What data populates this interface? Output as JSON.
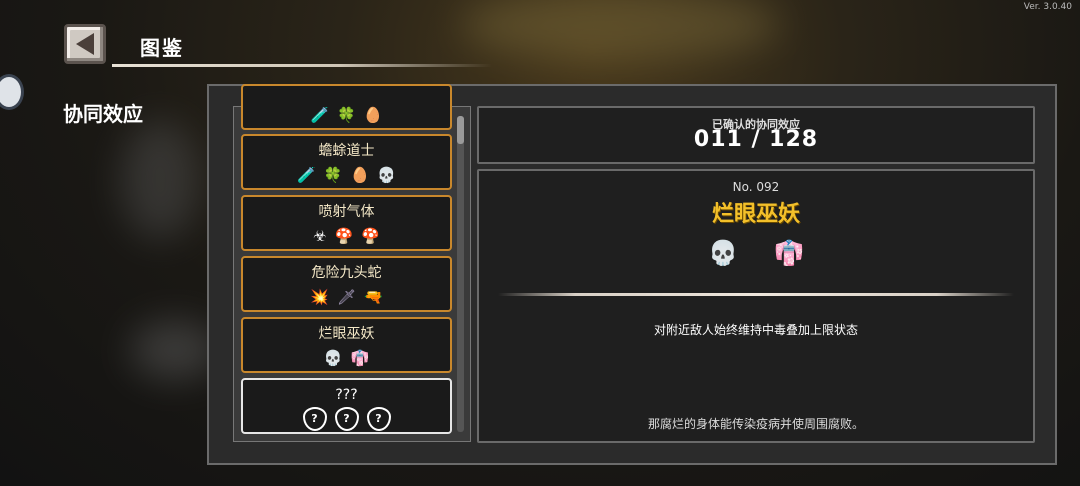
{
  "version": "Ver. 3.0.40",
  "header": {
    "title": "图鉴"
  },
  "side_heading": "协同效应",
  "list": {
    "cards": [
      {
        "name": "",
        "icons": [
          "🧪",
          "🍀",
          "🥚"
        ],
        "colors": [
          "#7a4ab0",
          "#4ea83a",
          "#c0548a"
        ],
        "partial": true
      },
      {
        "name": "蟾蜍道士",
        "icons": [
          "🧪",
          "🍀",
          "🥚",
          "💀"
        ],
        "colors": [
          "#7a4ab0",
          "#4ea83a",
          "#c0548a",
          "#cfc0a6"
        ]
      },
      {
        "name": "喷射气体",
        "icons": [
          "☣",
          "🍄",
          "🍄"
        ],
        "colors": [
          "#ffffff",
          "#4a8ed8",
          "#d2473a"
        ]
      },
      {
        "name": "危险九头蛇",
        "icons": [
          "💥",
          "🗡",
          "🔫"
        ],
        "colors": [
          "#ffffff",
          "#b0a4c8",
          "#a05a4a"
        ]
      },
      {
        "name": "烂眼巫妖",
        "icons": [
          "💀",
          "👘"
        ],
        "colors": [
          "#cfc0a6",
          "#c24aa0"
        ]
      },
      {
        "name": "???",
        "icons": [
          "?",
          "?",
          "?"
        ],
        "colors": [
          "#ffffff",
          "#ffffff",
          "#ffffff"
        ],
        "unknown": true
      }
    ]
  },
  "counter": {
    "label": "已确认的协同效应",
    "value": "011 / 128"
  },
  "detail": {
    "number": "No. 092",
    "name": "烂眼巫妖",
    "icons": [
      "💀",
      "👘"
    ],
    "colors": [
      "#cfc0a6",
      "#c24aa0"
    ],
    "effect": "对附近敌人始终维持中毒叠加上限状态",
    "flavor": "那腐烂的身体能传染疫病并使周围腐败。"
  }
}
